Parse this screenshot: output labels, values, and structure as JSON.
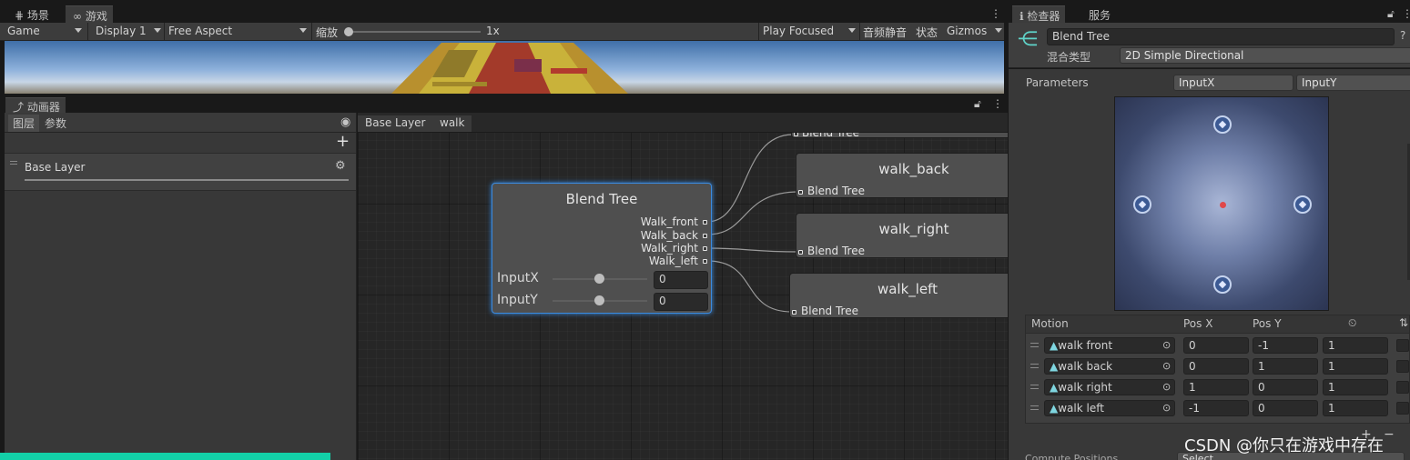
{
  "game_window": {
    "tabs": [
      {
        "label": "场景"
      },
      {
        "label": "游戏"
      }
    ],
    "toolbar": {
      "display_mode": "Game",
      "display": "Display 1",
      "aspect": "Free Aspect",
      "scale_label": "缩放",
      "scale_value": "1x",
      "play_mode": "Play Focused",
      "mute": "音频静音",
      "stats": "状态",
      "gizmos": "Gizmos"
    }
  },
  "animator": {
    "tab": {
      "label": "动画器"
    },
    "left_tabs": [
      {
        "label": "图层"
      },
      {
        "label": "参数"
      }
    ],
    "layers": [
      {
        "name": "Base Layer"
      }
    ],
    "breadcrumb": [
      "Base Layer",
      "walk"
    ],
    "blend_tree_node": {
      "title": "Blend Tree",
      "outputs": [
        "Walk_front",
        "Walk_back",
        "Walk_right",
        "Walk_left"
      ],
      "params": [
        {
          "name": "InputX",
          "value": "0",
          "level": 0.5
        },
        {
          "name": "InputY",
          "value": "0",
          "level": 0.5
        }
      ]
    },
    "motion_nodes": [
      {
        "title": "",
        "sub": "Blend Tree"
      },
      {
        "title": "walk_back",
        "sub": "Blend Tree"
      },
      {
        "title": "walk_right",
        "sub": "Blend Tree"
      },
      {
        "title": "walk_left",
        "sub": "Blend Tree"
      }
    ]
  },
  "inspector": {
    "tabs": [
      {
        "label": "检查器"
      },
      {
        "label": "服务"
      }
    ],
    "name": "Blend Tree",
    "blend_type_label": "混合类型",
    "blend_type": "2D Simple Directional",
    "parameters_label": "Parameters",
    "param_x": "InputX",
    "param_y": "InputY",
    "blend_points": [
      {
        "x": 0,
        "y": 1
      },
      {
        "x": -1,
        "y": 0
      },
      {
        "x": 1,
        "y": 0
      },
      {
        "x": 0,
        "y": -1
      }
    ],
    "current_point": {
      "x": 0,
      "y": 0
    },
    "table": {
      "headers": {
        "motion": "Motion",
        "pos_x": "Pos X",
        "pos_y": "Pos Y"
      },
      "rows": [
        {
          "motion": "walk front",
          "pos_x": "0",
          "pos_y": "-1",
          "speed": "1"
        },
        {
          "motion": "walk back",
          "pos_x": "0",
          "pos_y": "1",
          "speed": "1"
        },
        {
          "motion": "walk right",
          "pos_x": "1",
          "pos_y": "0",
          "speed": "1"
        },
        {
          "motion": "walk left",
          "pos_x": "-1",
          "pos_y": "0",
          "speed": "1"
        }
      ]
    },
    "compute_positions_label": "Compute Positions",
    "compute_positions_value": "Select"
  },
  "watermark": "CSDN @你只在游戏中存在",
  "colors": {
    "accent": "#13d0a8",
    "node_highlight": "#3b8be0",
    "current_point": "#e0484a"
  }
}
